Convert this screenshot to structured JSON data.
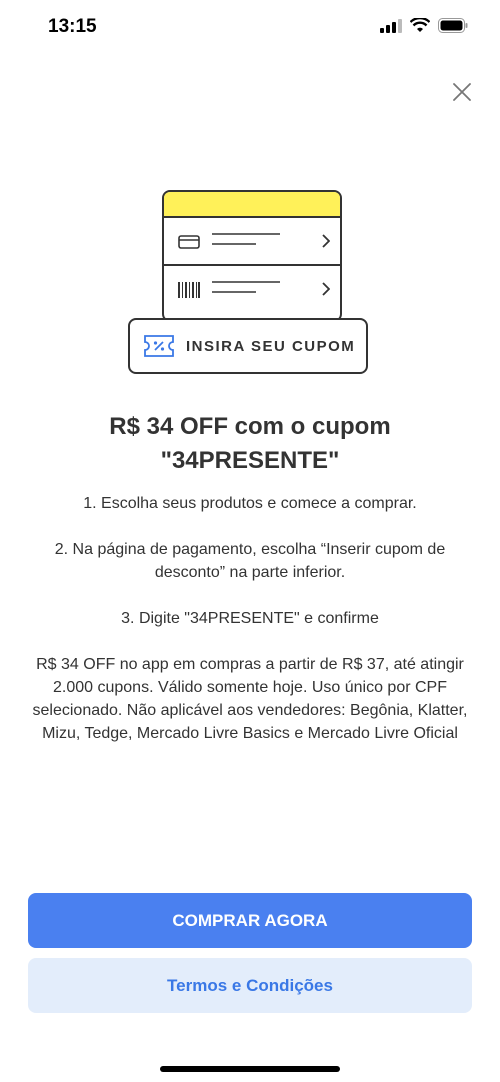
{
  "status_bar": {
    "time": "13:15"
  },
  "illustration": {
    "coupon_label": "INSIRA SEU CUPOM"
  },
  "title": "R$ 34 OFF com o cupom \"34PRESENTE\"",
  "steps": [
    "1. Escolha seus produtos e comece a comprar.",
    "2. Na página de pagamento, escolha “Inserir cupom de desconto” na parte inferior.",
    "3. Digite \"34PRESENTE\" e confirme"
  ],
  "terms_text": "R$ 34 OFF no app em compras a partir de R$ 37, até atingir 2.000 cupons. Válido somente hoje. Uso único por CPF selecionado. Não aplicável aos vendedores: Begônia, Klatter, Mizu, Tedge, Mercado Livre Basics e Mercado Livre Oficial",
  "buttons": {
    "primary": "COMPRAR AGORA",
    "secondary": "Termos e Condições"
  },
  "colors": {
    "primary": "#4a80f0",
    "secondary_bg": "#e3edfb",
    "accent_yellow": "#fff159",
    "coupon_blue": "#3a78e6"
  }
}
